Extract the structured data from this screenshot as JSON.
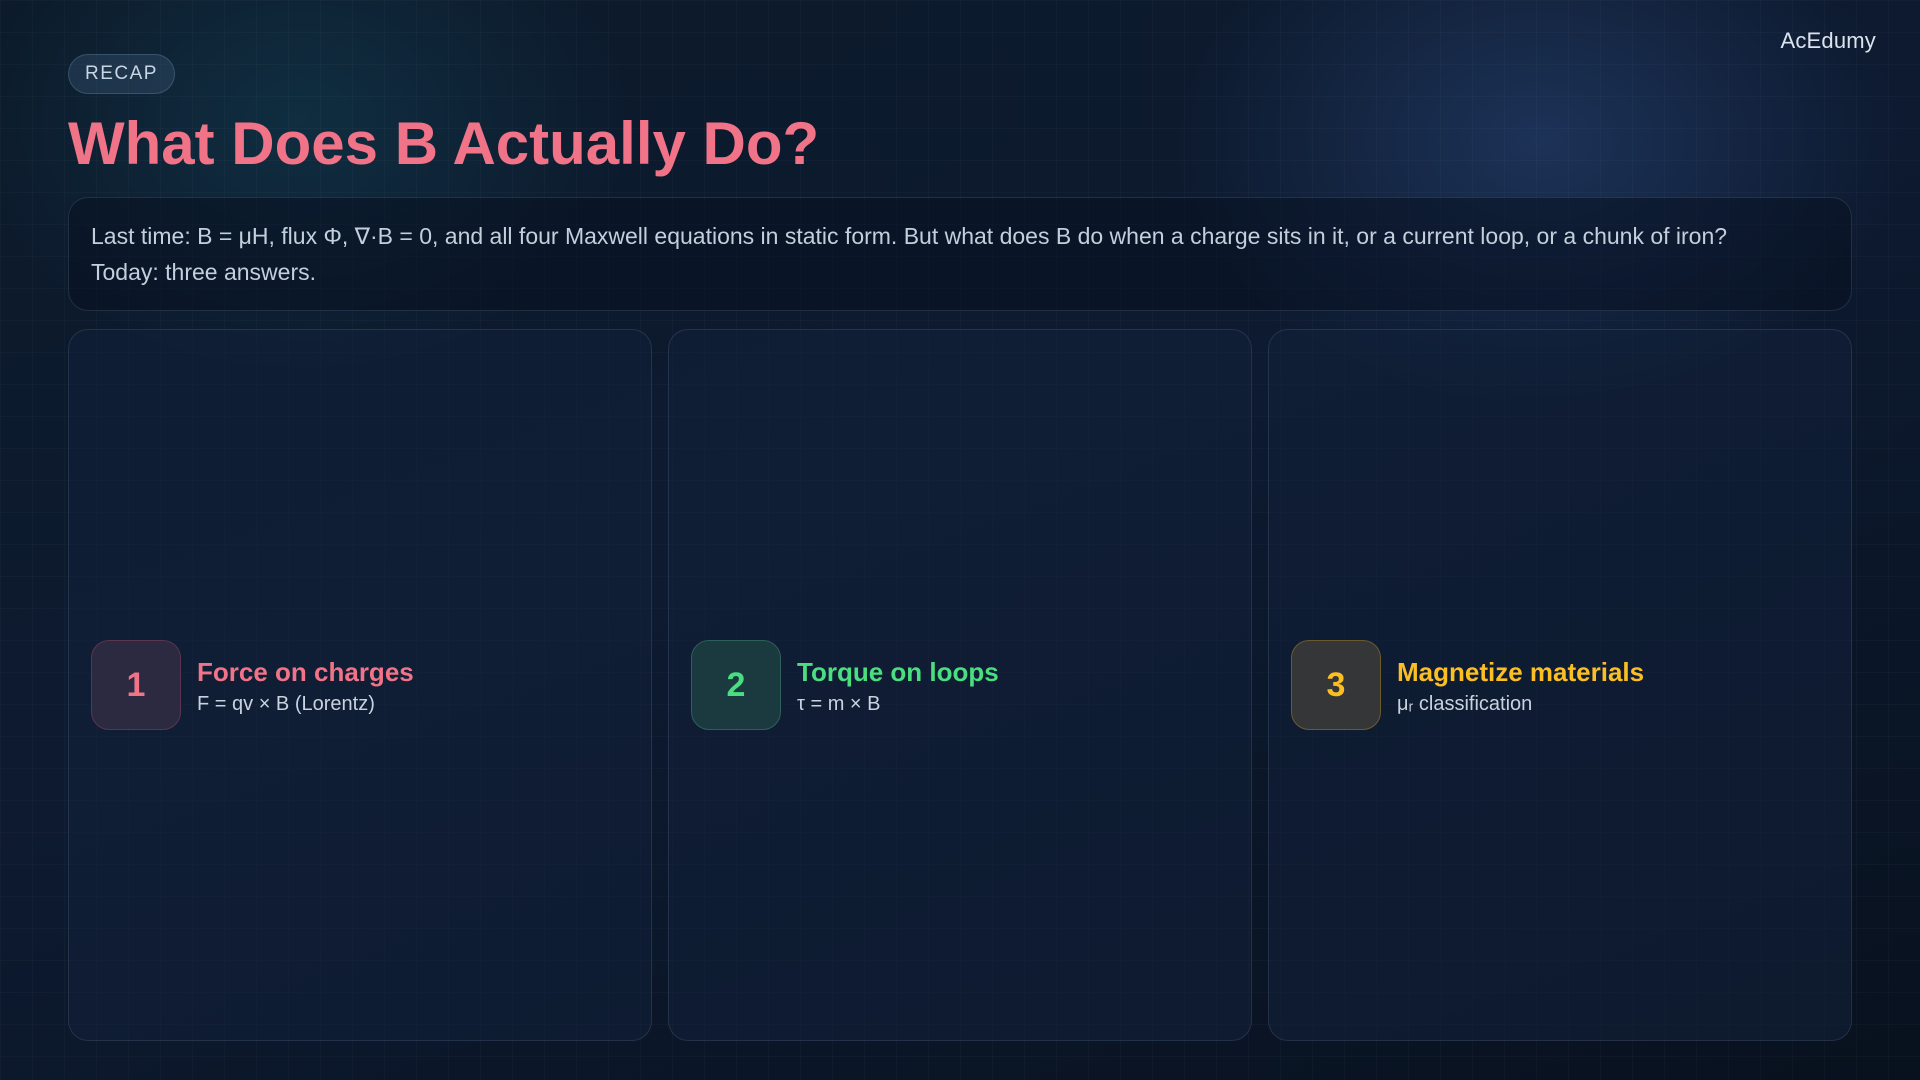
{
  "brand": "AcEdumy",
  "badge": "RECAP",
  "title": "What Does B Actually Do?",
  "intro": {
    "line1": "Last time: B = μH, flux Φ, ∇·B = 0, and all four Maxwell equations in static form. But what does B do when a charge sits in it, or a current loop, or a chunk of iron?",
    "line2": "Today: three answers."
  },
  "cards": [
    {
      "number": "1",
      "title": "Force on charges",
      "subtitle": "F = qv × B (Lorentz)",
      "accent": "#f07388"
    },
    {
      "number": "2",
      "title": "Torque on loops",
      "subtitle": "τ = m × B",
      "accent": "#4ade80"
    },
    {
      "number": "3",
      "title": "Magnetize materials",
      "subtitle": "μᵣ classification",
      "accent": "#fbbf24"
    }
  ],
  "colors": {
    "background": "#0c1a2a",
    "title": "#f07388"
  }
}
